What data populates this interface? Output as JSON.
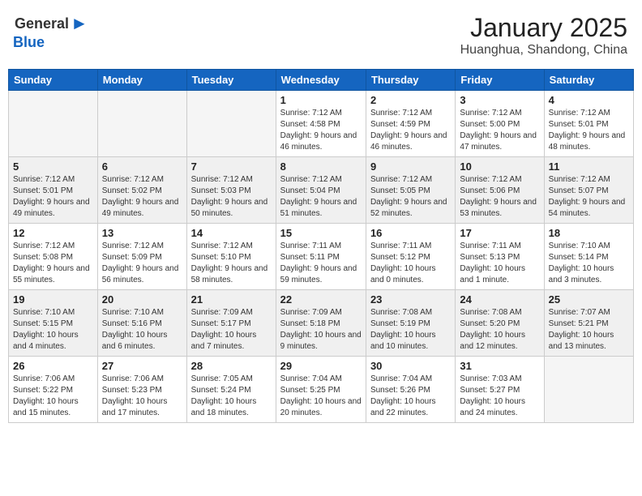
{
  "header": {
    "logo_general": "General",
    "logo_blue": "Blue",
    "month": "January 2025",
    "location": "Huanghua, Shandong, China"
  },
  "weekdays": [
    "Sunday",
    "Monday",
    "Tuesday",
    "Wednesday",
    "Thursday",
    "Friday",
    "Saturday"
  ],
  "weeks": [
    [
      {
        "day": "",
        "empty": true
      },
      {
        "day": "",
        "empty": true
      },
      {
        "day": "",
        "empty": true
      },
      {
        "day": "1",
        "sunrise": "7:12 AM",
        "sunset": "4:58 PM",
        "daylight": "9 hours and 46 minutes."
      },
      {
        "day": "2",
        "sunrise": "7:12 AM",
        "sunset": "4:59 PM",
        "daylight": "9 hours and 46 minutes."
      },
      {
        "day": "3",
        "sunrise": "7:12 AM",
        "sunset": "5:00 PM",
        "daylight": "9 hours and 47 minutes."
      },
      {
        "day": "4",
        "sunrise": "7:12 AM",
        "sunset": "5:01 PM",
        "daylight": "9 hours and 48 minutes."
      }
    ],
    [
      {
        "day": "5",
        "sunrise": "7:12 AM",
        "sunset": "5:01 PM",
        "daylight": "9 hours and 49 minutes."
      },
      {
        "day": "6",
        "sunrise": "7:12 AM",
        "sunset": "5:02 PM",
        "daylight": "9 hours and 49 minutes."
      },
      {
        "day": "7",
        "sunrise": "7:12 AM",
        "sunset": "5:03 PM",
        "daylight": "9 hours and 50 minutes."
      },
      {
        "day": "8",
        "sunrise": "7:12 AM",
        "sunset": "5:04 PM",
        "daylight": "9 hours and 51 minutes."
      },
      {
        "day": "9",
        "sunrise": "7:12 AM",
        "sunset": "5:05 PM",
        "daylight": "9 hours and 52 minutes."
      },
      {
        "day": "10",
        "sunrise": "7:12 AM",
        "sunset": "5:06 PM",
        "daylight": "9 hours and 53 minutes."
      },
      {
        "day": "11",
        "sunrise": "7:12 AM",
        "sunset": "5:07 PM",
        "daylight": "9 hours and 54 minutes."
      }
    ],
    [
      {
        "day": "12",
        "sunrise": "7:12 AM",
        "sunset": "5:08 PM",
        "daylight": "9 hours and 55 minutes."
      },
      {
        "day": "13",
        "sunrise": "7:12 AM",
        "sunset": "5:09 PM",
        "daylight": "9 hours and 56 minutes."
      },
      {
        "day": "14",
        "sunrise": "7:12 AM",
        "sunset": "5:10 PM",
        "daylight": "9 hours and 58 minutes."
      },
      {
        "day": "15",
        "sunrise": "7:11 AM",
        "sunset": "5:11 PM",
        "daylight": "9 hours and 59 minutes."
      },
      {
        "day": "16",
        "sunrise": "7:11 AM",
        "sunset": "5:12 PM",
        "daylight": "10 hours and 0 minutes."
      },
      {
        "day": "17",
        "sunrise": "7:11 AM",
        "sunset": "5:13 PM",
        "daylight": "10 hours and 1 minute."
      },
      {
        "day": "18",
        "sunrise": "7:10 AM",
        "sunset": "5:14 PM",
        "daylight": "10 hours and 3 minutes."
      }
    ],
    [
      {
        "day": "19",
        "sunrise": "7:10 AM",
        "sunset": "5:15 PM",
        "daylight": "10 hours and 4 minutes."
      },
      {
        "day": "20",
        "sunrise": "7:10 AM",
        "sunset": "5:16 PM",
        "daylight": "10 hours and 6 minutes."
      },
      {
        "day": "21",
        "sunrise": "7:09 AM",
        "sunset": "5:17 PM",
        "daylight": "10 hours and 7 minutes."
      },
      {
        "day": "22",
        "sunrise": "7:09 AM",
        "sunset": "5:18 PM",
        "daylight": "10 hours and 9 minutes."
      },
      {
        "day": "23",
        "sunrise": "7:08 AM",
        "sunset": "5:19 PM",
        "daylight": "10 hours and 10 minutes."
      },
      {
        "day": "24",
        "sunrise": "7:08 AM",
        "sunset": "5:20 PM",
        "daylight": "10 hours and 12 minutes."
      },
      {
        "day": "25",
        "sunrise": "7:07 AM",
        "sunset": "5:21 PM",
        "daylight": "10 hours and 13 minutes."
      }
    ],
    [
      {
        "day": "26",
        "sunrise": "7:06 AM",
        "sunset": "5:22 PM",
        "daylight": "10 hours and 15 minutes."
      },
      {
        "day": "27",
        "sunrise": "7:06 AM",
        "sunset": "5:23 PM",
        "daylight": "10 hours and 17 minutes."
      },
      {
        "day": "28",
        "sunrise": "7:05 AM",
        "sunset": "5:24 PM",
        "daylight": "10 hours and 18 minutes."
      },
      {
        "day": "29",
        "sunrise": "7:04 AM",
        "sunset": "5:25 PM",
        "daylight": "10 hours and 20 minutes."
      },
      {
        "day": "30",
        "sunrise": "7:04 AM",
        "sunset": "5:26 PM",
        "daylight": "10 hours and 22 minutes."
      },
      {
        "day": "31",
        "sunrise": "7:03 AM",
        "sunset": "5:27 PM",
        "daylight": "10 hours and 24 minutes."
      },
      {
        "day": "",
        "empty": true
      }
    ]
  ],
  "labels": {
    "sunrise": "Sunrise: ",
    "sunset": "Sunset: ",
    "daylight": "Daylight: "
  }
}
